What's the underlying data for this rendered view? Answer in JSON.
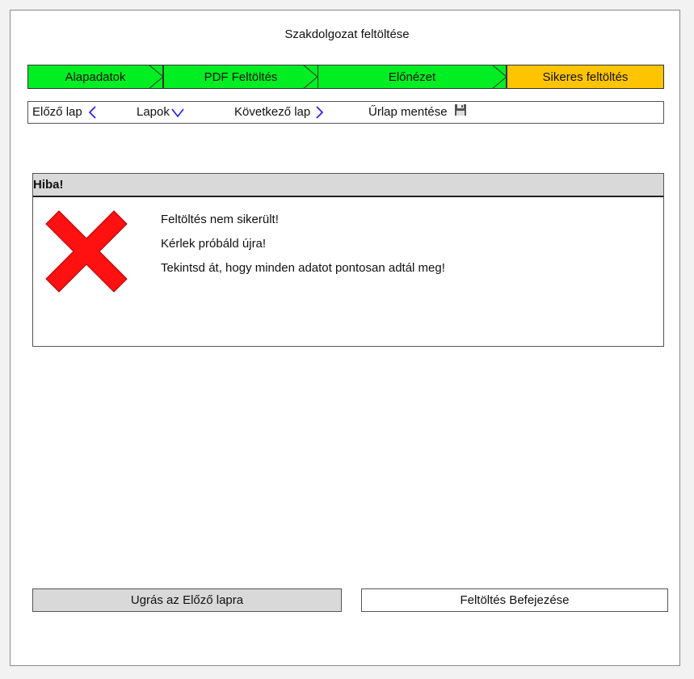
{
  "page": {
    "title": "Szakdolgozat feltöltése"
  },
  "steps": [
    {
      "label": "Alapadatok",
      "color": "#00ee22"
    },
    {
      "label": "PDF Feltöltés",
      "color": "#00ee22"
    },
    {
      "label": "Előnézet",
      "color": "#00ee22"
    },
    {
      "label": "Sikeres feltöltés",
      "color": "#ffc400"
    }
  ],
  "toolbar": {
    "prev_label": "Előző lap",
    "pages_label": "Lapok",
    "next_label": "Következő lap",
    "save_label": "Űrlap mentése",
    "icon_color": "#1a1aff"
  },
  "error_panel": {
    "heading": "Hiba!",
    "icon": "error-x-icon",
    "icon_color": "#ff1111",
    "messages": [
      "Feltöltés nem sikerült!",
      "Kérlek próbáld újra!",
      "Tekintsd át, hogy minden adatot pontosan adtál meg!"
    ]
  },
  "buttons": {
    "prev_page": "Ugrás az Előző lapra",
    "finish": "Feltöltés Befejezése"
  }
}
